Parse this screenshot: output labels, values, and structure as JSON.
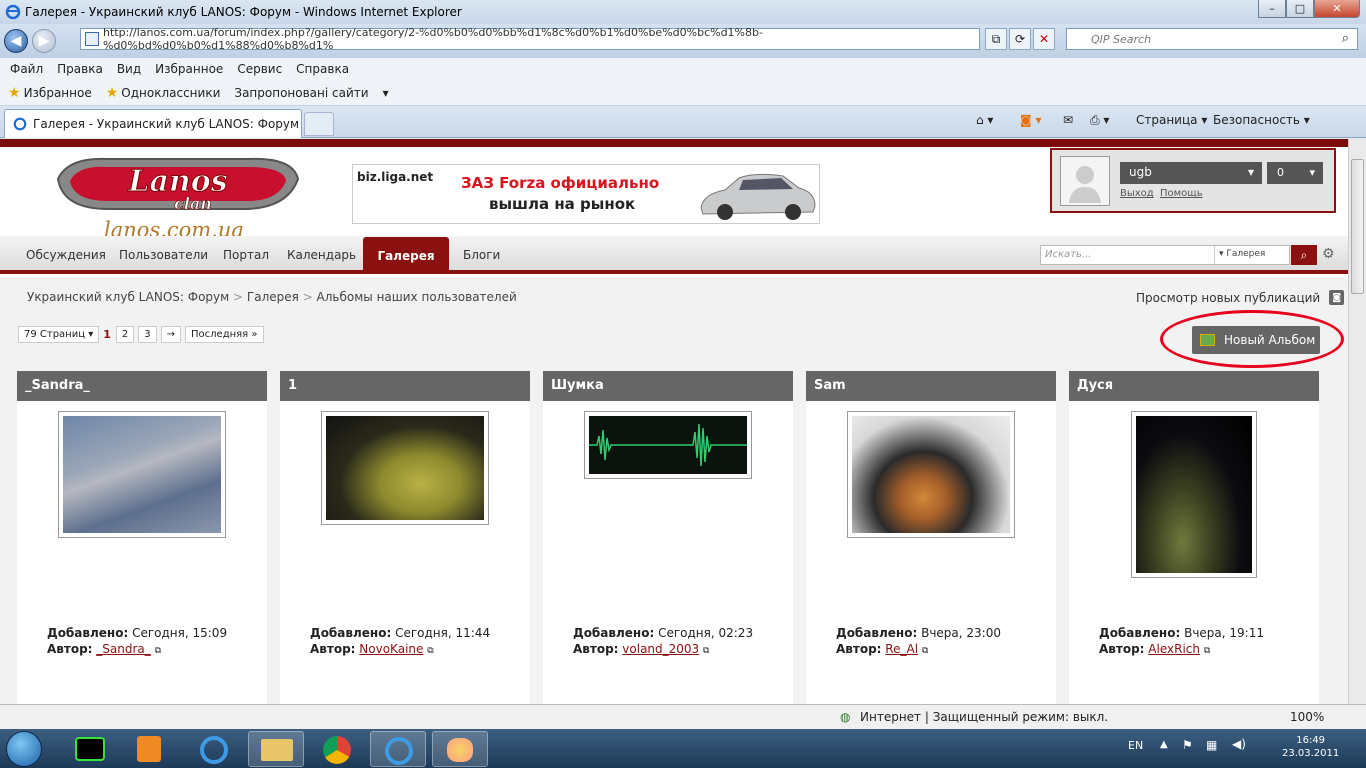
{
  "window": {
    "title": "Галерея - Украинский клуб LANOS: Форум - Windows Internet Explorer"
  },
  "address": {
    "url": "http://lanos.com.ua/forum/index.php?/gallery/category/2-%d0%b0%d0%bb%d1%8c%d0%b1%d0%be%d0%bc%d1%8b-%d0%bd%d0%b0%d1%88%d0%b8%d1%",
    "search_placeholder": "QIP Search"
  },
  "menu": [
    "Файл",
    "Правка",
    "Вид",
    "Избранное",
    "Сервис",
    "Справка"
  ],
  "favorites": {
    "label": "Избранное",
    "items": [
      "Одноклассники",
      "Запропоновані сайти"
    ]
  },
  "tab": {
    "title": "Галерея - Украинский клуб LANOS: Форум"
  },
  "commands": {
    "page": "Страница",
    "safety": "Безопасность"
  },
  "site": {
    "logo_main": "Lanos",
    "logo_sub": "clan",
    "logo_url": "lanos.com.ua",
    "banner": {
      "source": "biz.liga.net",
      "line1": "ЗАЗ Forza официально",
      "line2": "вышла на рынок"
    },
    "user": {
      "name": "ugb",
      "count": "0",
      "logout": "Выход",
      "help": "Помощь"
    },
    "nav": [
      "Обсуждения",
      "Пользователи",
      "Портал",
      "Календарь",
      "Галерея",
      "Блоги"
    ],
    "search": {
      "placeholder": "Искать...",
      "scope": "Галерея"
    },
    "breadcrumb": [
      "Украинский клуб LANOS: Форум",
      "Галерея",
      "Альбомы наших пользователей"
    ],
    "new_pubs": "Просмотр новых публикаций",
    "pager": {
      "total": "79 Страниц",
      "pages": [
        "1",
        "2",
        "3"
      ],
      "next": "→",
      "last": "Последняя »"
    },
    "new_album": "Новый Альбом",
    "added_label": "Добавлено:",
    "author_label": "Автор:",
    "albums": [
      {
        "title": "_Sandra_",
        "added": "Сегодня, 15:09",
        "author": "_Sandra_"
      },
      {
        "title": "1",
        "added": "Сегодня, 11:44",
        "author": "NovoKaine"
      },
      {
        "title": "Шумка",
        "added": "Сегодня, 02:23",
        "author": "voland_2003"
      },
      {
        "title": "Sam",
        "added": "Вчера, 23:00",
        "author": "Re_Al"
      },
      {
        "title": "Дуся",
        "added": "Вчера, 19:11",
        "author": "AlexRich"
      }
    ]
  },
  "status": {
    "zone": "Интернет | Защищенный режим: выкл.",
    "zoom": "100%"
  },
  "taskbar": {
    "lang": "EN",
    "time": "16:49",
    "date": "23.03.2011"
  }
}
